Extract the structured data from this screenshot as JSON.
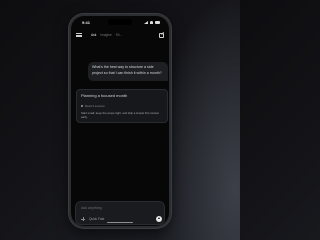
{
  "status_bar": {
    "time": "9:41"
  },
  "header": {
    "tabs": [
      {
        "label": "Ask",
        "active": true
      },
      {
        "label": "Imagine",
        "active": false
      },
      {
        "label": "Sh...",
        "active": false
      }
    ]
  },
  "conversation": {
    "user_message": "What's the best way to structure a side project so that I can finish it within a month?",
    "answer": {
      "title": "Planning a focused month",
      "step": "Read 3 sources",
      "body": "Start small, keep the scope tight, and ship a simple first version early."
    }
  },
  "composer": {
    "placeholder": "Ask anything",
    "model_label": "Quick Fast"
  },
  "colors": {
    "accent": "#e8e8e8",
    "background": "#070708"
  }
}
